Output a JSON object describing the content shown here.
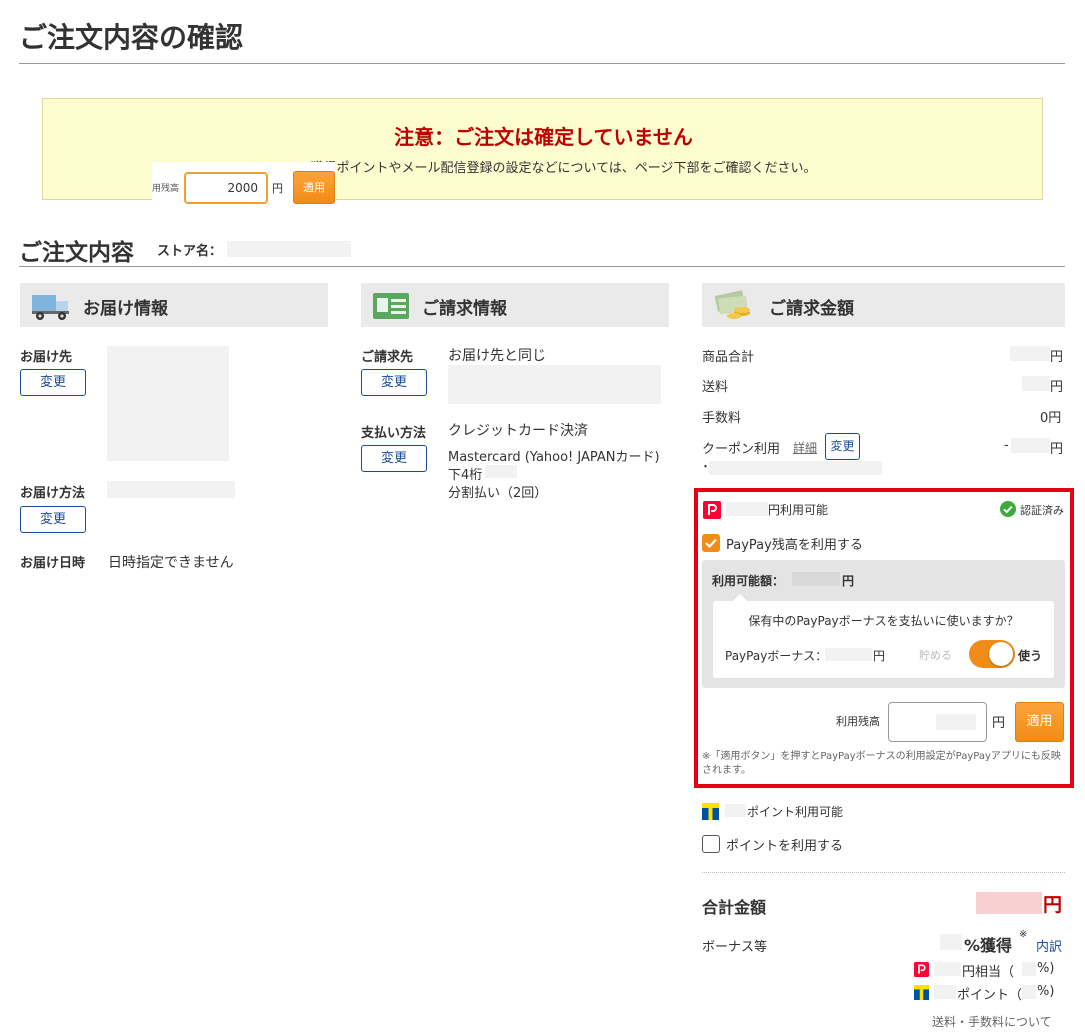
{
  "page_title": "ご注文内容の確認",
  "notice": {
    "title": "注意：ご注文は確定していません",
    "text": "獲得ポイントやメール配信登録の設定などについては、ページ下部をご確認ください。",
    "overlay_label": "用残高",
    "overlay_value": "2000",
    "overlay_unit": "円",
    "overlay_apply": "適用"
  },
  "order": {
    "heading": "ご注文内容",
    "store_label": "ストア名："
  },
  "delivery": {
    "heading": "お届け情報",
    "dest_label": "お届け先",
    "change": "変更",
    "method_label": "お届け方法",
    "date_label": "お届け日時",
    "date_value": "日時指定できません"
  },
  "billing": {
    "heading": "ご請求情報",
    "address_label": "ご請求先",
    "address_value": "お届け先と同じ",
    "change": "変更",
    "payment_label": "支払い方法",
    "payment_value": "クレジットカード決済",
    "card": "Mastercard (Yahoo! JAPANカード)",
    "last4": "下4桁",
    "installments": "分割払い（2回）"
  },
  "amount": {
    "heading": "ご請求金額",
    "rows": [
      {
        "label": "商品合計",
        "value": "円"
      },
      {
        "label": "送料",
        "value": "円"
      },
      {
        "label": "手数料",
        "value": "0円"
      }
    ],
    "coupon_label": "クーポン利用",
    "coupon_detail": "詳細",
    "coupon_change": "変更",
    "coupon_prefix": "-",
    "coupon_unit": "円",
    "coupon_bullet": "・"
  },
  "paypay": {
    "available_suffix": "円利用可能",
    "verified": "認証済み",
    "use_balance": "PayPay残高を利用する",
    "usable_amount_label": "利用可能額：",
    "usable_amount_unit": "円",
    "bonus_question": "保有中のPayPayボーナスを支払いに使いますか？",
    "bonus_label": "PayPayボーナス：",
    "bonus_unit": "円",
    "save": "貯める",
    "use": "使う",
    "balance_label": "利用残高",
    "balance_unit": "円",
    "apply": "適用",
    "note": "※「適用ボタン」を押すとPayPayボーナスの利用設定がPayPayアプリにも反映されます。"
  },
  "tpoint": {
    "available": "ポイント利用可能",
    "use": "ポイントを利用する"
  },
  "total": {
    "label": "合計金額",
    "unit": "円",
    "bonus_label": "ボーナス等",
    "percent": "%獲得",
    "sup": "※",
    "breakdown": "内訳",
    "paypay_equiv": "円相当（",
    "paypay_pct": "%)",
    "tpoint": "ポイント（",
    "tpoint_pct": "%)",
    "footer_note": "送料・手数料について"
  },
  "colors": {
    "accent_red": "#e60012",
    "orange": "#f39800",
    "link_blue": "#1a4b9a",
    "notice_bg": "#fefdd0",
    "paypay_red": "#ff0033",
    "tpoint_blue": "#0050a0",
    "tpoint_yellow": "#ffe100"
  }
}
